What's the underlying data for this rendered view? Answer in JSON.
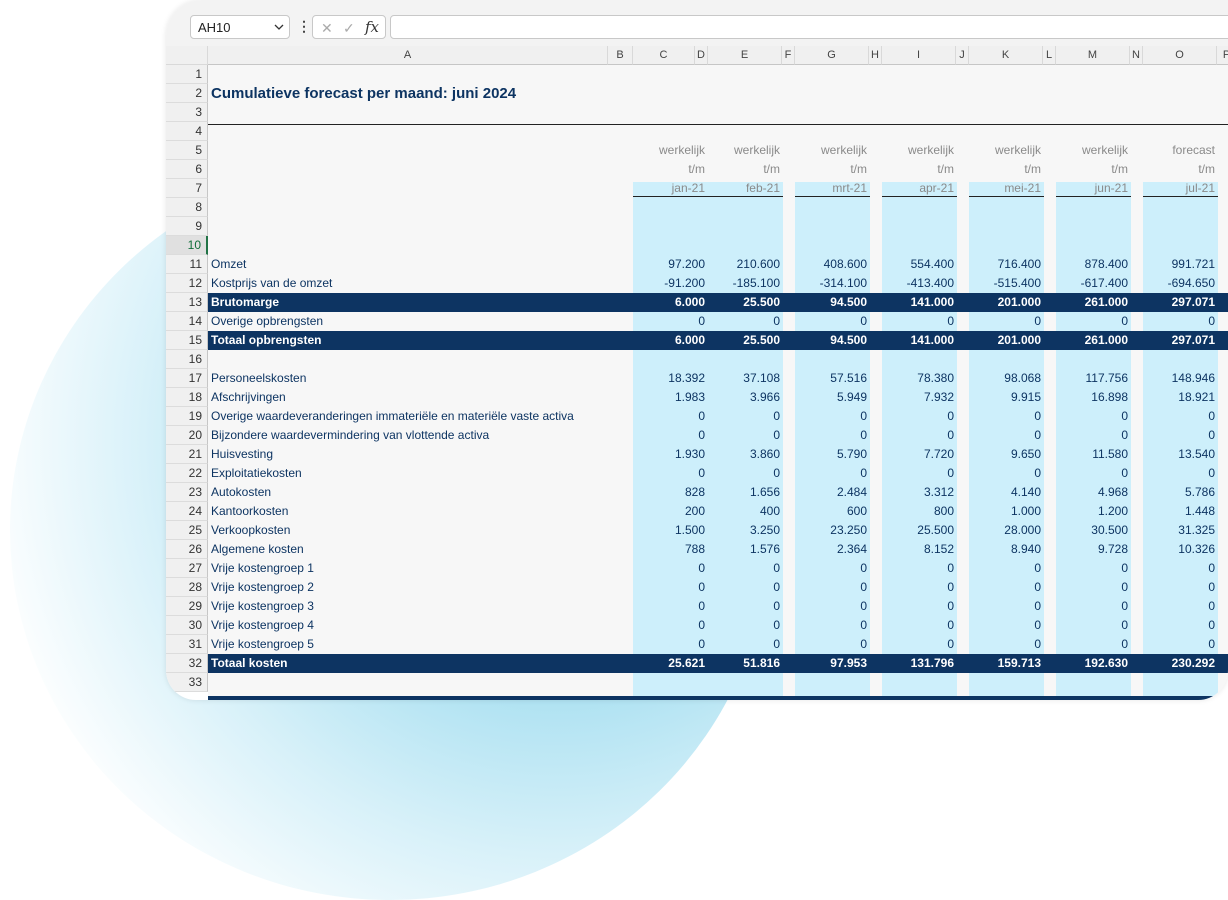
{
  "formula_bar": {
    "name_box": "AH10",
    "fx_label": "fx",
    "formula_value": ""
  },
  "title": "Cumulatieve forecast per maand: juni 2024",
  "column_letters": [
    "A",
    "B",
    "C",
    "D",
    "E",
    "F",
    "G",
    "H",
    "I",
    "J",
    "K",
    "L",
    "M",
    "N",
    "O",
    "P"
  ],
  "row_numbers": [
    1,
    2,
    3,
    4,
    5,
    6,
    7,
    8,
    9,
    10,
    11,
    12,
    13,
    14,
    15,
    16,
    17,
    18,
    19,
    20,
    21,
    22,
    23,
    24,
    25,
    26,
    27,
    28,
    29,
    30,
    31,
    32,
    33
  ],
  "selected_row": 10,
  "periods": [
    {
      "type": "werkelijk",
      "tm": "t/m",
      "month": "jan-21"
    },
    {
      "type": "werkelijk",
      "tm": "t/m",
      "month": "feb-21"
    },
    {
      "type": "werkelijk",
      "tm": "t/m",
      "month": "mrt-21"
    },
    {
      "type": "werkelijk",
      "tm": "t/m",
      "month": "apr-21"
    },
    {
      "type": "werkelijk",
      "tm": "t/m",
      "month": "mei-21"
    },
    {
      "type": "werkelijk",
      "tm": "t/m",
      "month": "jun-21"
    },
    {
      "type": "forecast",
      "tm": "t/m",
      "month": "jul-21"
    }
  ],
  "rows": [
    {
      "row": 11,
      "label": "Omzet",
      "values": [
        "97.200",
        "210.600",
        "408.600",
        "554.400",
        "716.400",
        "878.400",
        "991.721"
      ],
      "style": "normal"
    },
    {
      "row": 12,
      "label": "Kostprijs van de omzet",
      "values": [
        "-91.200",
        "-185.100",
        "-314.100",
        "-413.400",
        "-515.400",
        "-617.400",
        "-694.650"
      ],
      "style": "normal"
    },
    {
      "row": 13,
      "label": "Brutomarge",
      "values": [
        "6.000",
        "25.500",
        "94.500",
        "141.000",
        "201.000",
        "261.000",
        "297.071"
      ],
      "style": "total"
    },
    {
      "row": 14,
      "label": "Overige opbrengsten",
      "values": [
        "0",
        "0",
        "0",
        "0",
        "0",
        "0",
        "0"
      ],
      "style": "normal"
    },
    {
      "row": 15,
      "label": "Totaal opbrengsten",
      "values": [
        "6.000",
        "25.500",
        "94.500",
        "141.000",
        "201.000",
        "261.000",
        "297.071"
      ],
      "style": "total"
    },
    {
      "row": 17,
      "label": "Personeelskosten",
      "values": [
        "18.392",
        "37.108",
        "57.516",
        "78.380",
        "98.068",
        "117.756",
        "148.946"
      ],
      "style": "normal"
    },
    {
      "row": 18,
      "label": "Afschrijvingen",
      "values": [
        "1.983",
        "3.966",
        "5.949",
        "7.932",
        "9.915",
        "16.898",
        "18.921"
      ],
      "style": "normal"
    },
    {
      "row": 19,
      "label": "Overige waardeveranderingen immateriële en materiële vaste activa",
      "values": [
        "0",
        "0",
        "0",
        "0",
        "0",
        "0",
        "0"
      ],
      "style": "normal"
    },
    {
      "row": 20,
      "label": "Bijzondere waardevermindering van vlottende activa",
      "values": [
        "0",
        "0",
        "0",
        "0",
        "0",
        "0",
        "0"
      ],
      "style": "normal"
    },
    {
      "row": 21,
      "label": "Huisvesting",
      "values": [
        "1.930",
        "3.860",
        "5.790",
        "7.720",
        "9.650",
        "11.580",
        "13.540"
      ],
      "style": "normal"
    },
    {
      "row": 22,
      "label": "Exploitatiekosten",
      "values": [
        "0",
        "0",
        "0",
        "0",
        "0",
        "0",
        "0"
      ],
      "style": "normal"
    },
    {
      "row": 23,
      "label": "Autokosten",
      "values": [
        "828",
        "1.656",
        "2.484",
        "3.312",
        "4.140",
        "4.968",
        "5.786"
      ],
      "style": "normal"
    },
    {
      "row": 24,
      "label": "Kantoorkosten",
      "values": [
        "200",
        "400",
        "600",
        "800",
        "1.000",
        "1.200",
        "1.448"
      ],
      "style": "normal"
    },
    {
      "row": 25,
      "label": "Verkoopkosten",
      "values": [
        "1.500",
        "3.250",
        "23.250",
        "25.500",
        "28.000",
        "30.500",
        "31.325"
      ],
      "style": "normal"
    },
    {
      "row": 26,
      "label": "Algemene kosten",
      "values": [
        "788",
        "1.576",
        "2.364",
        "8.152",
        "8.940",
        "9.728",
        "10.326"
      ],
      "style": "normal"
    },
    {
      "row": 27,
      "label": "Vrije kostengroep 1",
      "values": [
        "0",
        "0",
        "0",
        "0",
        "0",
        "0",
        "0"
      ],
      "style": "normal"
    },
    {
      "row": 28,
      "label": "Vrije kostengroep 2",
      "values": [
        "0",
        "0",
        "0",
        "0",
        "0",
        "0",
        "0"
      ],
      "style": "normal"
    },
    {
      "row": 29,
      "label": "Vrije kostengroep 3",
      "values": [
        "0",
        "0",
        "0",
        "0",
        "0",
        "0",
        "0"
      ],
      "style": "normal"
    },
    {
      "row": 30,
      "label": "Vrije kostengroep 4",
      "values": [
        "0",
        "0",
        "0",
        "0",
        "0",
        "0",
        "0"
      ],
      "style": "normal"
    },
    {
      "row": 31,
      "label": "Vrije kostengroep 5",
      "values": [
        "0",
        "0",
        "0",
        "0",
        "0",
        "0",
        "0"
      ],
      "style": "normal"
    },
    {
      "row": 32,
      "label": "Totaal kosten",
      "values": [
        "25.621",
        "51.816",
        "97.953",
        "131.796",
        "159.713",
        "192.630",
        "230.292"
      ],
      "style": "total"
    }
  ],
  "colors": {
    "dark_navy": "#0d3462",
    "highlight_band": "#cdeffb",
    "header_gray": "#f0f0f0"
  }
}
